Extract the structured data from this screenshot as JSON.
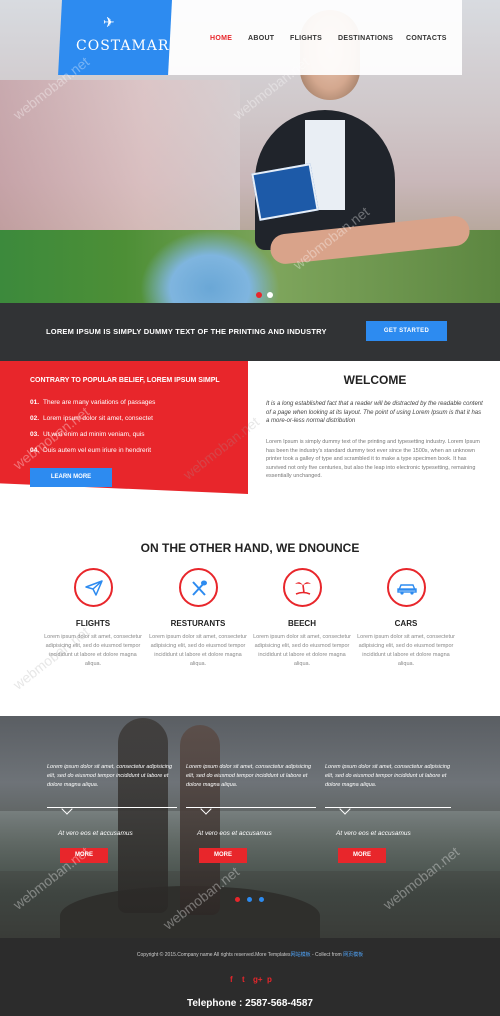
{
  "brand": {
    "name": "COSTAMAR",
    "icon": "airplane-icon"
  },
  "nav": [
    {
      "label": "HOME",
      "active": true
    },
    {
      "label": "ABOUT"
    },
    {
      "label": "FLIGHTS"
    },
    {
      "label": "DESTINATIONS"
    },
    {
      "label": "CONTACTS"
    }
  ],
  "hero": {
    "slides": 2,
    "active_slide": 1
  },
  "cta": {
    "text": "LOREM IPSUM IS SIMPLY DUMMY TEXT OF THE PRINTING AND INDUSTRY",
    "button": "GET STARTED"
  },
  "red_panel": {
    "title": "CONTRARY TO POPULAR BELIEF, LOREM IPSUM SIMPL",
    "items": [
      {
        "num": "01.",
        "text": "There are many variations of passages"
      },
      {
        "num": "02.",
        "text": "Lorem ipsum dolor sit amet, consectet"
      },
      {
        "num": "03.",
        "text": "Ut wisi enim ad minim veniam, quis"
      },
      {
        "num": "04.",
        "text": "Duis autem vel eum iriure in hendrerit"
      }
    ],
    "button": "LEARN MORE"
  },
  "welcome": {
    "title": "WELCOME",
    "italic": "It is a long established fact that a reader will be distracted by the readable content of a page when looking at its layout. The point of using Lorem Ipsum is that it has a more-or-less normal distribution",
    "body": "Lorem Ipsum is simply dummy text of the printing and typesetting industry. Lorem Ipsum has been the industry's standard dummy text ever since the 1500s, when an unknown printer took a galley of type and scrambled it to make a type specimen book. It has survived not only five centuries, but also the leap into electronic typesetting, remaining essentially unchanged."
  },
  "services": {
    "heading": "ON THE OTHER HAND, WE DNOUNCE",
    "items": [
      {
        "title": "FLIGHTS",
        "icon": "paper-plane-icon",
        "text": "Lorem ipsum dolor sit amet, consectetur adipisicing elit, sed do eiusmod tempor incididunt ut labore et dolore magna aliqua."
      },
      {
        "title": "RESTURANTS",
        "icon": "fork-spoon-icon",
        "text": "Lorem ipsum dolor sit amet, consectetur adipisicing elit, sed do eiusmod tempor incididunt ut labore et dolore magna aliqua."
      },
      {
        "title": "BEECH",
        "icon": "palm-tree-icon",
        "text": "Lorem ipsum dolor sit amet, consectetur adipisicing elit, sed do eiusmod tempor incididunt ut labore et dolore magna aliqua."
      },
      {
        "title": "CARS",
        "icon": "car-icon",
        "text": "Lorem ipsum dolor sit amet, consectetur adipisicing elit, sed do eiusmod tempor incididunt ut labore et dolore magna aliqua."
      }
    ]
  },
  "testimonials": {
    "items": [
      {
        "text": "Lorem ipsum dolor sit amet, consectetur adipisicing elit, sed do eiusmod tempor incididunt ut labore et dolore magna aliqua.",
        "author": "At vero eos et accusamus",
        "button": "MORE"
      },
      {
        "text": "Lorem ipsum dolor sit amet, consectetur adipisicing elit, sed do eiusmod tempor incididunt ut labore et dolore magna aliqua.",
        "author": "At vero eos et accusamus",
        "button": "MORE"
      },
      {
        "text": "Lorem ipsum dolor sit amet, consectetur adipisicing elit, sed do eiusmod tempor incididunt ut labore et dolore magna aliqua.",
        "author": "At vero eos et accusamus",
        "button": "MORE"
      }
    ],
    "dots": 3,
    "active_dot": 1
  },
  "footer": {
    "copyright": "Copyright © 2015.Company name All rights reserved.More Templates",
    "link1": "网站模板",
    "collect": " - Collect from ",
    "link2": "网页模板",
    "social": [
      "f",
      "t",
      "g+",
      "p"
    ],
    "telephone": "Telephone : 2587-568-4587"
  },
  "watermark": "webmoban.net",
  "colors": {
    "accent_red": "#e8262b",
    "accent_blue": "#2d8bf0",
    "dark": "#313335"
  }
}
